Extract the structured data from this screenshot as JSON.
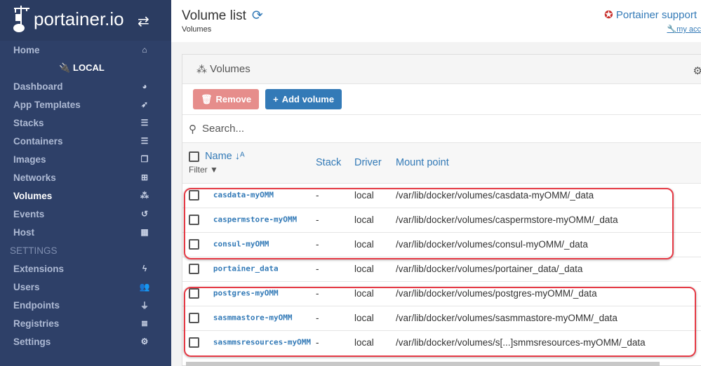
{
  "brand": {
    "logo": "portainer.io",
    "toggle_icon": "exchange-icon"
  },
  "sidebar": {
    "items": [
      {
        "label": "Home",
        "icon": "home-icon",
        "glyph": "⌂"
      },
      {
        "label": "LOCAL",
        "type": "title",
        "icon": "plug-icon",
        "glyph": "🔌"
      },
      {
        "label": "Dashboard",
        "icon": "tachometer-icon",
        "glyph": "◕"
      },
      {
        "label": "App Templates",
        "icon": "rocket-icon",
        "glyph": "➶"
      },
      {
        "label": "Stacks",
        "icon": "th-list-icon",
        "glyph": "☰"
      },
      {
        "label": "Containers",
        "icon": "server-icon",
        "glyph": "☰"
      },
      {
        "label": "Images",
        "icon": "clone-icon",
        "glyph": "❐"
      },
      {
        "label": "Networks",
        "icon": "sitemap-icon",
        "glyph": "⊞"
      },
      {
        "label": "Volumes",
        "icon": "cubes-icon",
        "glyph": "⁂",
        "active": true
      },
      {
        "label": "Events",
        "icon": "history-icon",
        "glyph": "↺"
      },
      {
        "label": "Host",
        "icon": "th-icon",
        "glyph": "▦"
      },
      {
        "label": "SETTINGS",
        "type": "section"
      },
      {
        "label": "Extensions",
        "icon": "bolt-icon",
        "glyph": "ϟ"
      },
      {
        "label": "Users",
        "icon": "users-icon",
        "glyph": "👥"
      },
      {
        "label": "Endpoints",
        "icon": "plug-icon",
        "glyph": "⏚"
      },
      {
        "label": "Registries",
        "icon": "database-icon",
        "glyph": "≣"
      },
      {
        "label": "Settings",
        "icon": "cogs-icon",
        "glyph": "⚙"
      }
    ]
  },
  "header": {
    "title": "Volume list",
    "breadcrumb": "Volumes",
    "support": "Portainer support",
    "account": "my acc"
  },
  "panel": {
    "title": "Volumes",
    "remove": "Remove",
    "add": "Add volume",
    "search_placeholder": "Search...",
    "columns": {
      "name": "Name",
      "filter": "Filter",
      "stack": "Stack",
      "driver": "Driver",
      "mount": "Mount point"
    },
    "rows": [
      {
        "name": "casdata-myOMM",
        "stack": "-",
        "driver": "local",
        "mount": "/var/lib/docker/volumes/casdata-myOMM/_data"
      },
      {
        "name": "caspermstore-myOMM",
        "stack": "-",
        "driver": "local",
        "mount": "/var/lib/docker/volumes/caspermstore-myOMM/_data"
      },
      {
        "name": "consul-myOMM",
        "stack": "-",
        "driver": "local",
        "mount": "/var/lib/docker/volumes/consul-myOMM/_data"
      },
      {
        "name": "portainer_data",
        "stack": "-",
        "driver": "local",
        "mount": "/var/lib/docker/volumes/portainer_data/_data"
      },
      {
        "name": "postgres-myOMM",
        "stack": "-",
        "driver": "local",
        "mount": "/var/lib/docker/volumes/postgres-myOMM/_data"
      },
      {
        "name": "sasmmastore-myOMM",
        "stack": "-",
        "driver": "local",
        "mount": "/var/lib/docker/volumes/sasmmastore-myOMM/_data"
      },
      {
        "name": "sasmmsresources-myOMM",
        "stack": "-",
        "driver": "local",
        "mount": "/var/lib/docker/volumes/s[...]smmsresources-myOMM/_data"
      }
    ]
  },
  "colors": {
    "sidebar": "#2e4068",
    "primary": "#337ab7",
    "danger_disabled": "#e68d8b",
    "highlight": "#e53a45"
  }
}
